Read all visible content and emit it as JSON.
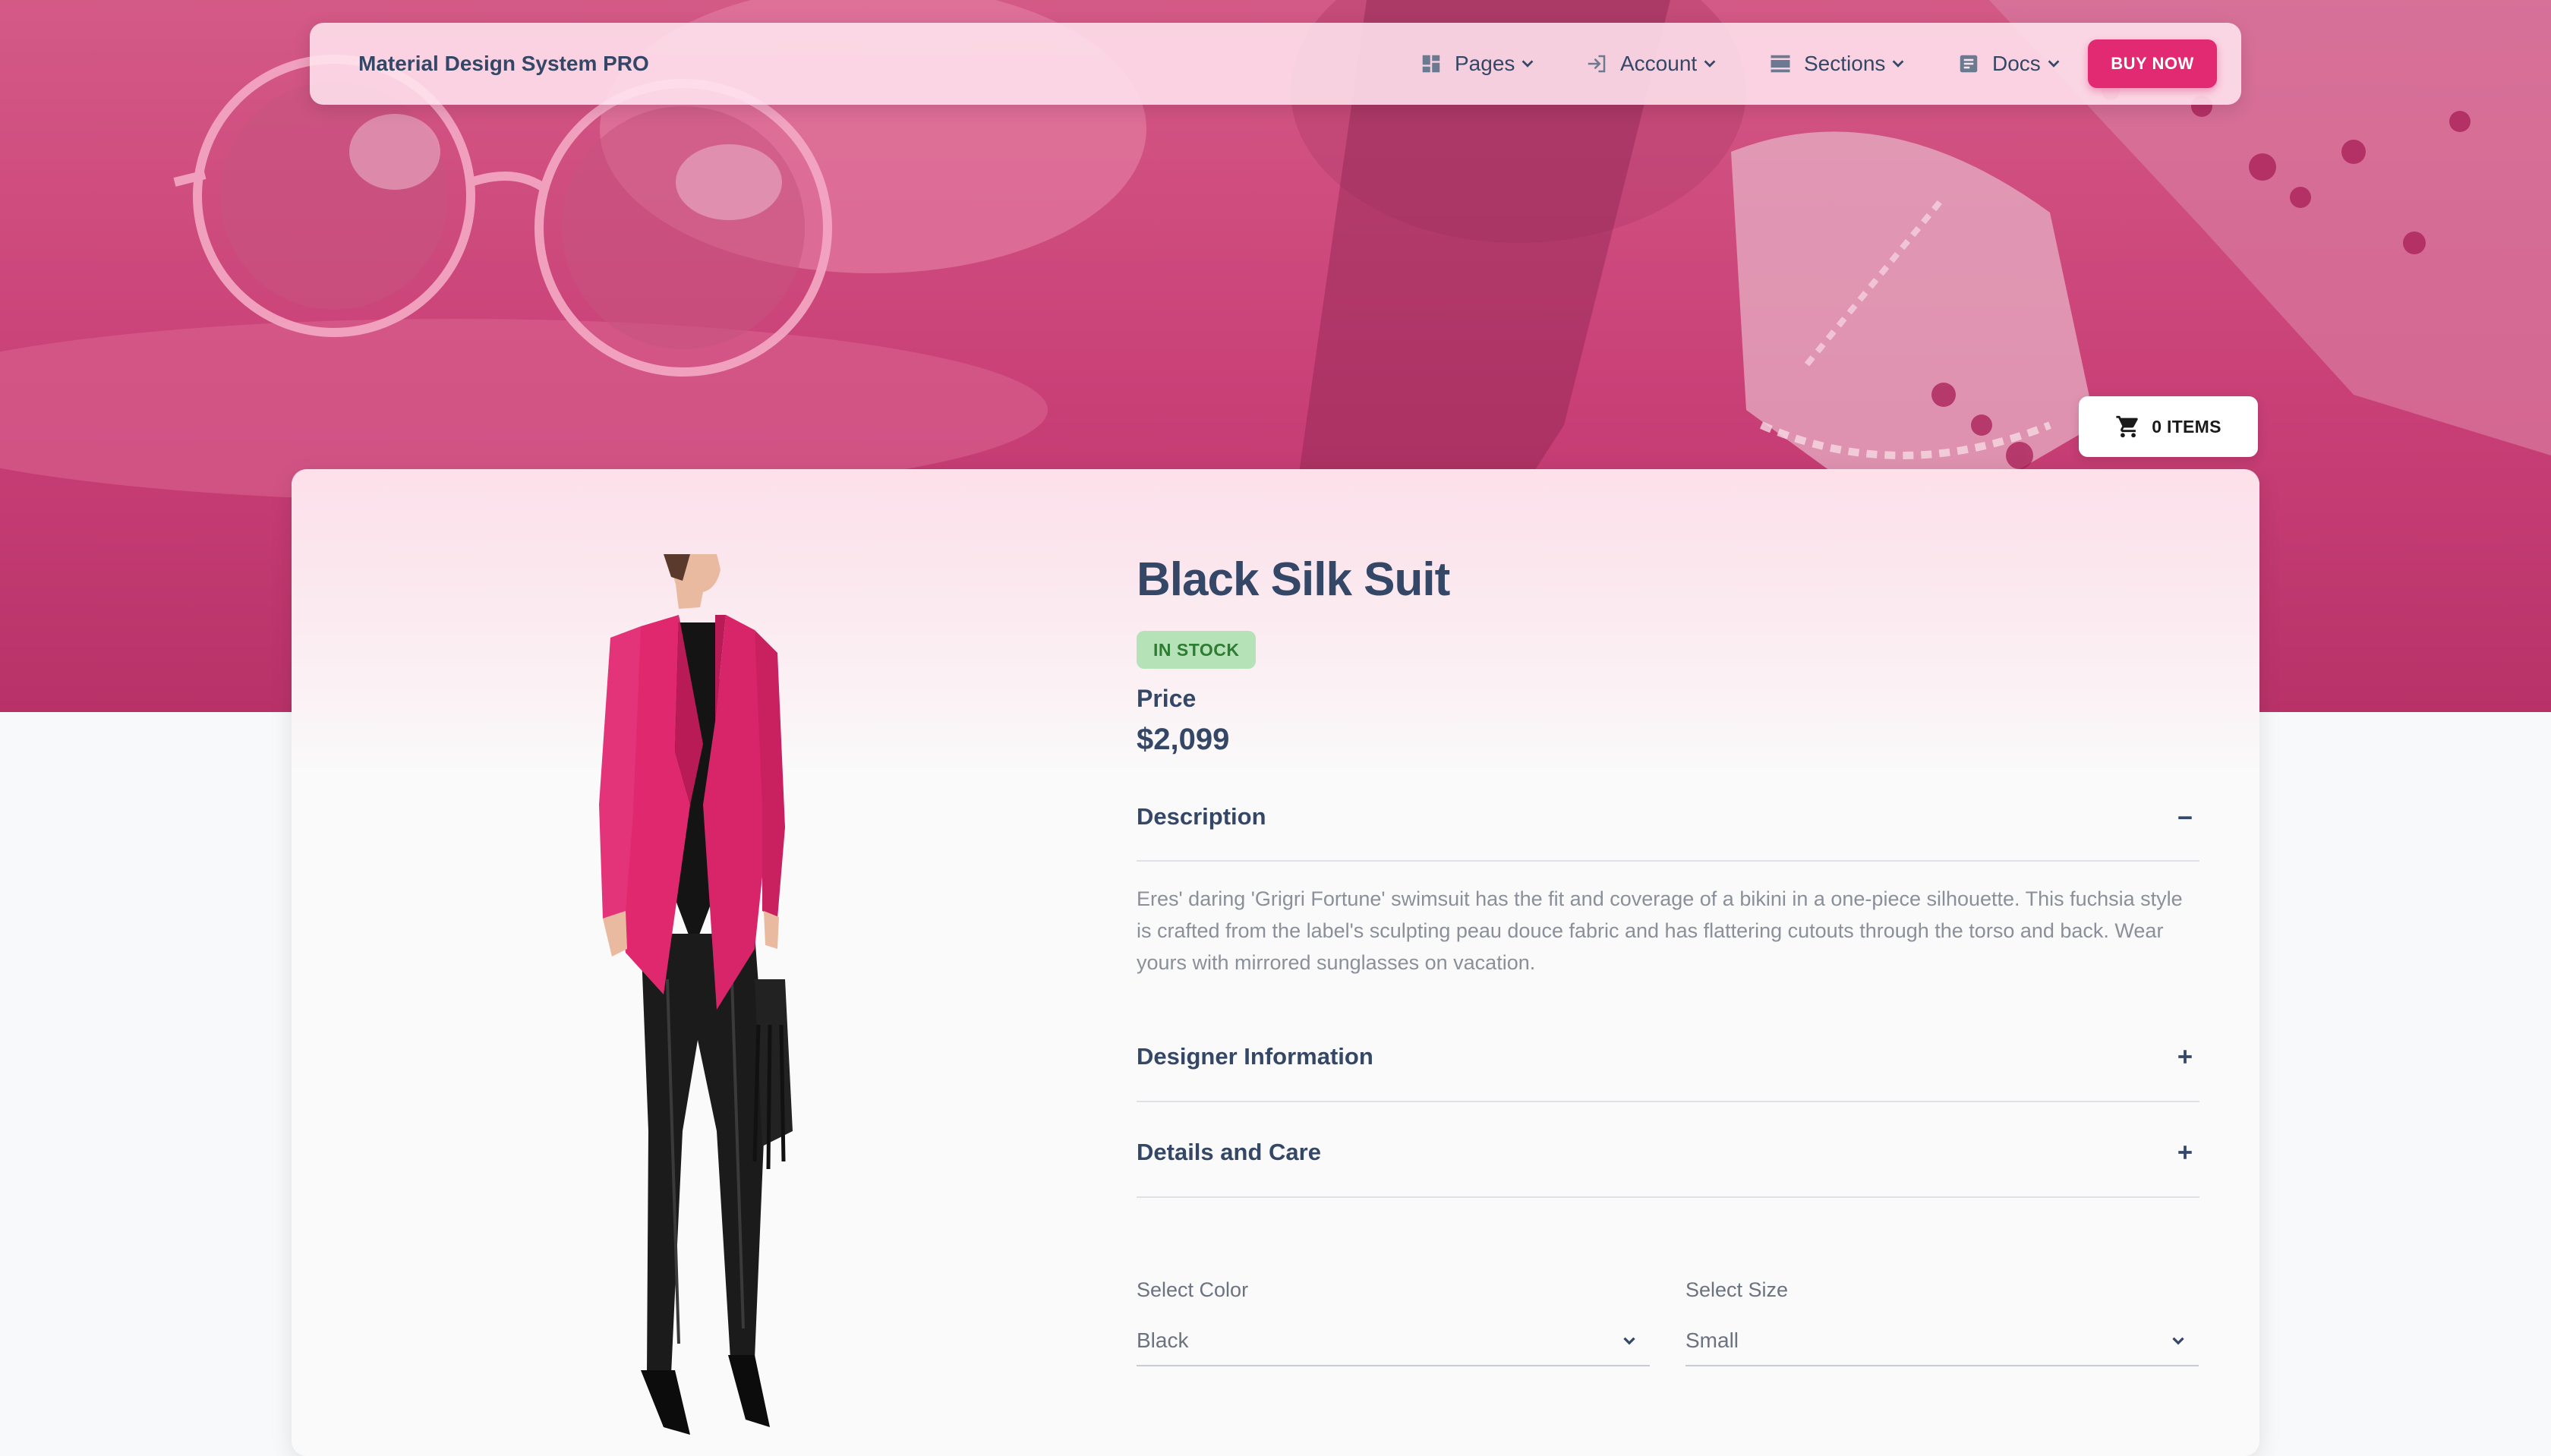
{
  "navbar": {
    "brand": "Material Design System PRO",
    "items": [
      {
        "label": "Pages",
        "icon": "dashboard-icon"
      },
      {
        "label": "Account",
        "icon": "login-icon"
      },
      {
        "label": "Sections",
        "icon": "view-day-icon"
      },
      {
        "label": "Docs",
        "icon": "article-icon"
      }
    ],
    "buy_now": "BUY NOW"
  },
  "cart": {
    "label": "0 ITEMS",
    "icon": "shopping-cart-icon"
  },
  "product": {
    "title": "Black Silk Suit",
    "stock_badge": "IN STOCK",
    "price_label": "Price",
    "price": "$2,099"
  },
  "accordion": [
    {
      "title": "Description",
      "expanded": true,
      "icon": "minus-icon",
      "body": "Eres' daring 'Grigri Fortune' swimsuit has the fit and coverage of a bikini in a one-piece silhouette. This fuchsia style is crafted from the label's sculpting peau douce fabric and has flattering cutouts through the torso and back. Wear yours with mirrored sunglasses on vacation."
    },
    {
      "title": "Designer Information",
      "expanded": false,
      "icon": "plus-icon"
    },
    {
      "title": "Details and Care",
      "expanded": false,
      "icon": "plus-icon"
    }
  ],
  "selects": {
    "color": {
      "label": "Select Color",
      "value": "Black"
    },
    "size": {
      "label": "Select Size",
      "value": "Small"
    }
  },
  "colors": {
    "accent": "#e22a72",
    "hero": "#c94077",
    "badge_bg": "#b6e2b8",
    "badge_text": "#2c7c31"
  }
}
